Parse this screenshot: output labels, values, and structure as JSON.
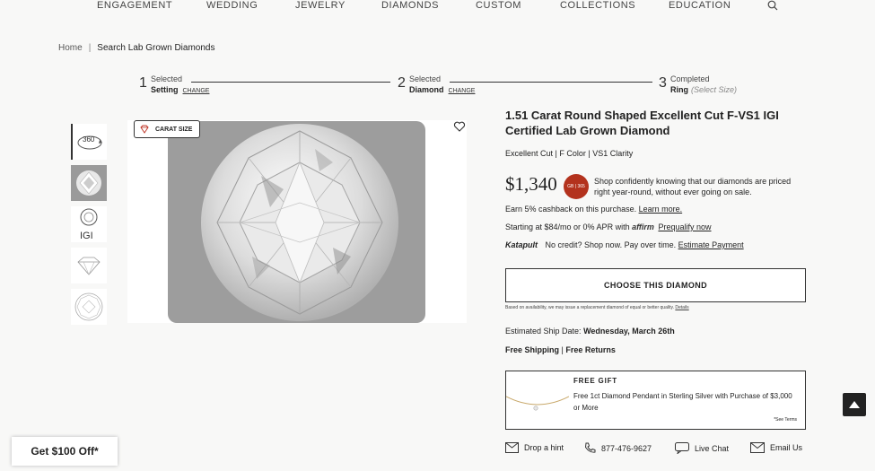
{
  "nav": {
    "items": [
      "ENGAGEMENT",
      "WEDDING",
      "JEWELRY",
      "DIAMONDS",
      "CUSTOM",
      "COLLECTIONS",
      "EDUCATION"
    ]
  },
  "breadcrumb": {
    "home": "Home",
    "separator": "|",
    "current": "Search Lab Grown Diamonds"
  },
  "steps": [
    {
      "num": "1",
      "label": "Selected",
      "value": "Setting",
      "action": "CHANGE"
    },
    {
      "num": "2",
      "label": "Selected",
      "value": "Diamond",
      "action": "CHANGE"
    },
    {
      "num": "3",
      "label": "Completed",
      "value": "Ring",
      "hint": "(Select Size)"
    }
  ],
  "gallery": {
    "thumb_360": "360",
    "thumb_igi": "IGI",
    "carat_button": "CARAT SIZE"
  },
  "product": {
    "title": "1.51 Carat Round Shaped Excellent Cut F-VS1 IGI Certified Lab Grown Diamond",
    "specs": "Excellent Cut | F Color | VS1 Clarity",
    "price": "$1,340",
    "badge_text": "GB | 365",
    "confidence_text": "Shop confidently knowing that our diamonds are priced right year-round, without ever going on sale.",
    "cashback_text": "Earn 5% cashback on this purchase.",
    "cashback_link": "Learn more.",
    "financing_text": "Starting at $84/mo or 0% APR with",
    "affirm_logo": "affirm",
    "prequalify_link": "Prequalify now",
    "katapult_logo": "Katapult",
    "katapult_text": "No credit? Shop now. Pay over time.",
    "estimate_link": "Estimate Payment",
    "choose_button": "CHOOSE THIS DIAMOND",
    "availability_text": "Based on availability, we may issue a replacement diamond of equal or better quality.",
    "availability_link": "Details",
    "ship_label": "Estimated Ship Date:",
    "ship_date": "Wednesday, March 26th",
    "free_shipping": "Free Shipping",
    "free_returns": "Free Returns"
  },
  "gift": {
    "heading": "FREE GIFT",
    "text": "Free 1ct Diamond Pendant in Sterling Silver with Purchase of $3,000 or More",
    "terms": "*See Terms"
  },
  "contact": {
    "hint": "Drop a hint",
    "phone": "877-476-9627",
    "chat": "Live Chat",
    "email": "Email Us"
  },
  "promo": {
    "label": "Get $100 Off*"
  },
  "colors": {
    "badge_red": "#b3321d",
    "dark": "#222222"
  }
}
